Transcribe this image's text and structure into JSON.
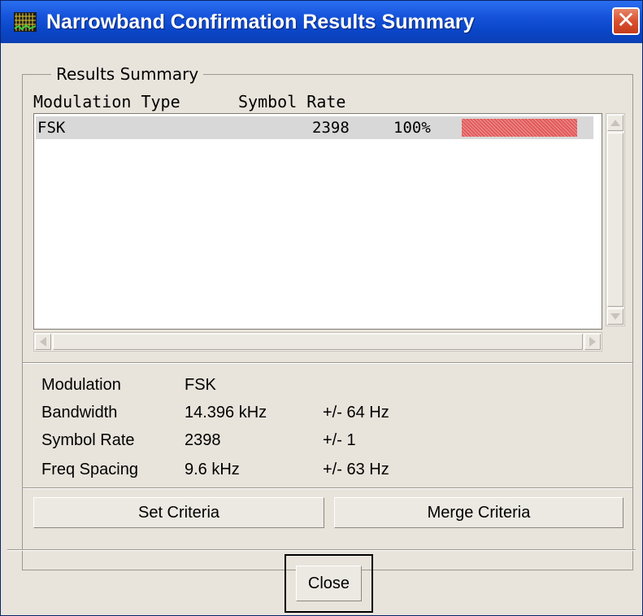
{
  "window": {
    "title": "Narrowband Confirmation Results Summary",
    "close_glyph": "✕"
  },
  "results_group": {
    "title": "Results Summary",
    "columns": [
      "Modulation Type",
      "Symbol Rate"
    ],
    "rows": [
      {
        "modulation": "FSK",
        "symbol_rate": "2398",
        "percent_text": "100%",
        "percent_value": 100
      }
    ]
  },
  "details": {
    "labels": {
      "modulation": "Modulation",
      "bandwidth": "Bandwidth",
      "symbol_rate": "Symbol Rate",
      "freq_spacing": "Freq Spacing"
    },
    "values": {
      "modulation": "FSK",
      "bandwidth": "14.396 kHz",
      "symbol_rate": "2398",
      "freq_spacing": "9.6 kHz"
    },
    "tolerances": {
      "bandwidth": "+/-  64 Hz",
      "symbol_rate": "+/-  1",
      "freq_spacing": "+/-  63 Hz"
    }
  },
  "buttons": {
    "set_criteria": "Set Criteria",
    "merge_criteria": "Merge Criteria",
    "close": "Close"
  },
  "colors": {
    "titlebar": "#0a46c8",
    "bar_fill": "#e25a5a",
    "selected_row": "#d8d8d8"
  },
  "icons": {
    "app": "waveform-grid-icon",
    "close": "close-icon"
  }
}
